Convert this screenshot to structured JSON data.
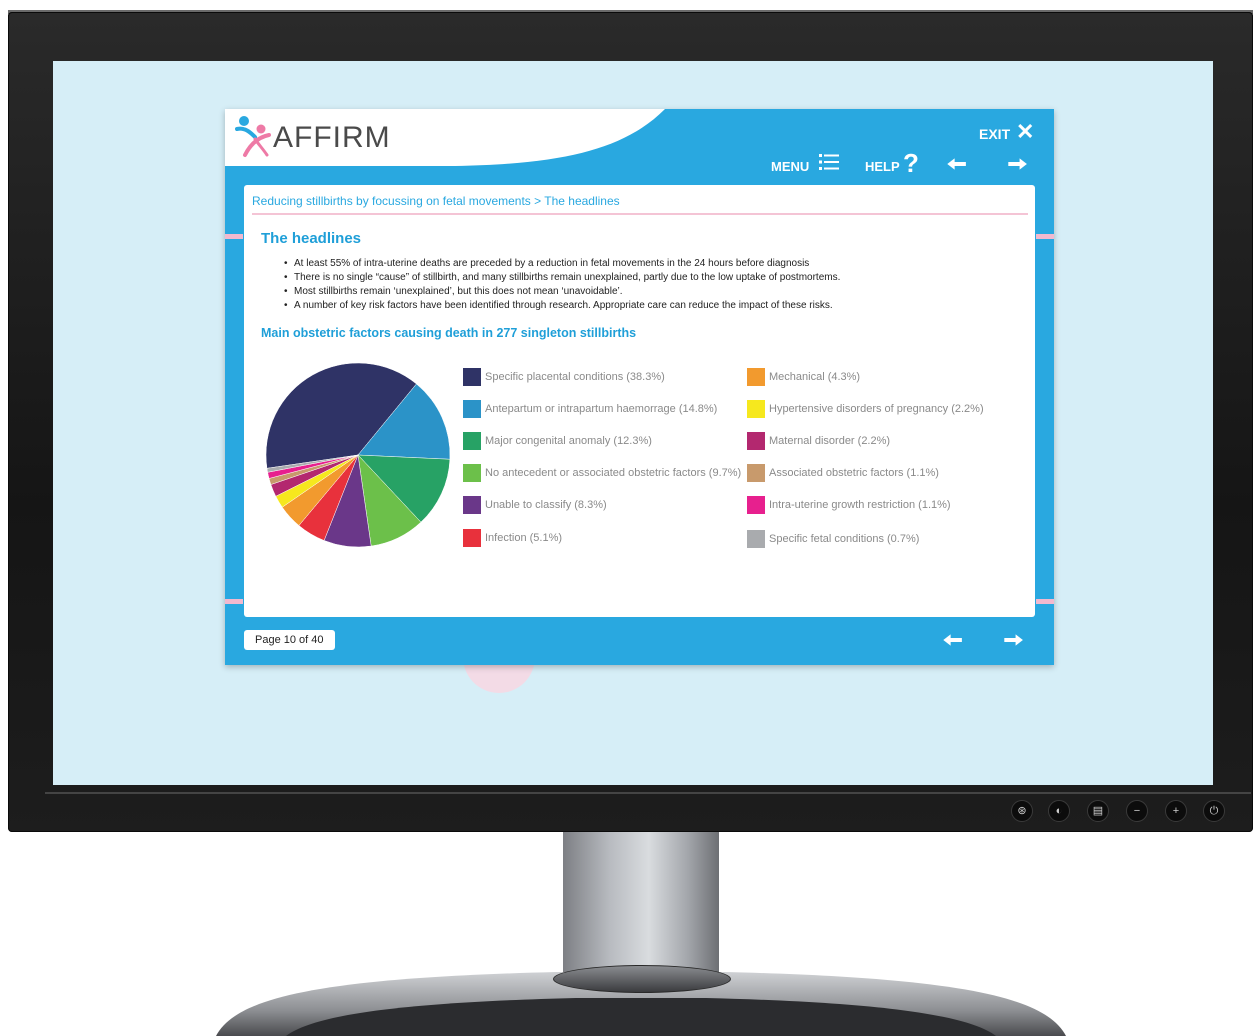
{
  "app": {
    "logo_text": "AFFIRM",
    "nav": {
      "exit_label": "EXIT",
      "menu_label": "MENU",
      "help_label": "HELP"
    }
  },
  "content": {
    "breadcrumb": "Reducing stillbirths by focussing on fetal movements > The headlines",
    "title": "The headlines",
    "bullets": [
      "At least 55% of intra-uterine deaths are preceded by a reduction in fetal movements in the 24 hours before diagnosis",
      "There is no single “cause” of stillbirth, and many stillbirths remain unexplained, partly due to the low uptake of postmortems.",
      "Most stillbirths remain ‘unexplained’, but this does not mean ‘unavoidable’.",
      "A number of key risk factors have been identified through research. Appropriate care can reduce the impact of these risks."
    ],
    "chart_title": "Main obstetric factors causing death in 277 singleton stillbirths",
    "legend_left": [
      "Specific placental conditions (38.3%)",
      "Antepartum or intrapartum haemorrage (14.8%)",
      "Major congenital anomaly (12.3%)",
      "No antecedent or associated obstetric factors (9.7%)",
      "Unable to classify (8.3%)",
      "Infection (5.1%)"
    ],
    "legend_right": [
      "Mechanical (4.3%)",
      "Hypertensive disorders of pregnancy (2.2%)",
      "Maternal disorder (2.2%)",
      "Associated obstetric factors (1.1%)",
      "Intra-uterine growth restriction (1.1%)",
      "Specific fetal conditions (0.7%)"
    ]
  },
  "footer": {
    "page_indicator": "Page 10 of 40"
  },
  "chart_data": {
    "type": "pie",
    "title": "Main obstetric factors causing death in 277 singleton stillbirths",
    "categories": [
      "Specific placental conditions",
      "Antepartum or intrapartum haemorrage",
      "Major congenital anomaly",
      "No antecedent or associated obstetric factors",
      "Unable to classify",
      "Infection",
      "Mechanical",
      "Hypertensive disorders of pregnancy",
      "Maternal disorder",
      "Associated obstetric factors",
      "Intra-uterine growth restriction",
      "Specific fetal conditions"
    ],
    "values": [
      38.3,
      14.8,
      12.3,
      9.7,
      8.3,
      5.1,
      4.3,
      2.2,
      2.2,
      1.1,
      1.1,
      0.7
    ],
    "colors": [
      "#2f3366",
      "#2b93c8",
      "#27a265",
      "#6cc04a",
      "#6a3789",
      "#e8313c",
      "#f29a2e",
      "#f6e81e",
      "#b3286f",
      "#c89a6c",
      "#e7208e",
      "#a9abae"
    ],
    "legend": "right"
  },
  "colors": {
    "accent": "#29a8e0",
    "screen_background": "#d6eef7",
    "pink_rule": "#f4c4d5"
  },
  "icons": {
    "monitor_controls": [
      "input-icon",
      "menu-icon",
      "settings-icon",
      "minus-icon",
      "plus-icon",
      "power-icon"
    ]
  }
}
